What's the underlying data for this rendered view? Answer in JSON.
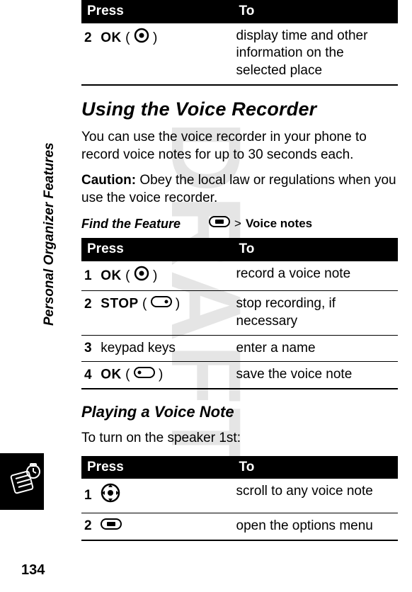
{
  "watermark": "DRAFT",
  "sidebar": {
    "section_label": "Personal Organizer Features"
  },
  "page_number": "134",
  "tables": {
    "top": {
      "headers": {
        "press": "Press",
        "to": "To"
      },
      "rows": [
        {
          "num": "2",
          "key": "OK",
          "paren_open": "(",
          "paren_close": ")",
          "to": "display time and other information on the selected place"
        }
      ]
    },
    "recorder": {
      "headers": {
        "press": "Press",
        "to": "To"
      },
      "rows": [
        {
          "num": "1",
          "key": "OK",
          "paren_open": "(",
          "paren_close": ")",
          "to": "record a voice note"
        },
        {
          "num": "2",
          "key": "STOP",
          "paren_open": "(",
          "paren_close": ")",
          "to": "stop recording, if necessary"
        },
        {
          "num": "3",
          "key": "keypad keys",
          "to": "enter a name"
        },
        {
          "num": "4",
          "key": "OK",
          "paren_open": "(",
          "paren_close": ")",
          "to": "save the voice note"
        }
      ]
    },
    "play": {
      "headers": {
        "press": "Press",
        "to": "To"
      },
      "rows": [
        {
          "num": "1",
          "to": "scroll to any voice note"
        },
        {
          "num": "2",
          "to": "open the options menu"
        }
      ]
    }
  },
  "headings": {
    "voice_recorder": "Using the Voice Recorder",
    "playing": "Playing a Voice Note"
  },
  "body": {
    "vr_intro": "You can use the voice recorder in your phone to record voice notes for up to 30 seconds each.",
    "caution_lead": "Caution:",
    "caution_rest": " Obey the local law or regulations when you use the voice recorder.",
    "play_intro": "To turn on the speaker 1st:"
  },
  "find_feature": {
    "label": "Find the Feature",
    "gt": ">",
    "path": "Voice notes"
  }
}
